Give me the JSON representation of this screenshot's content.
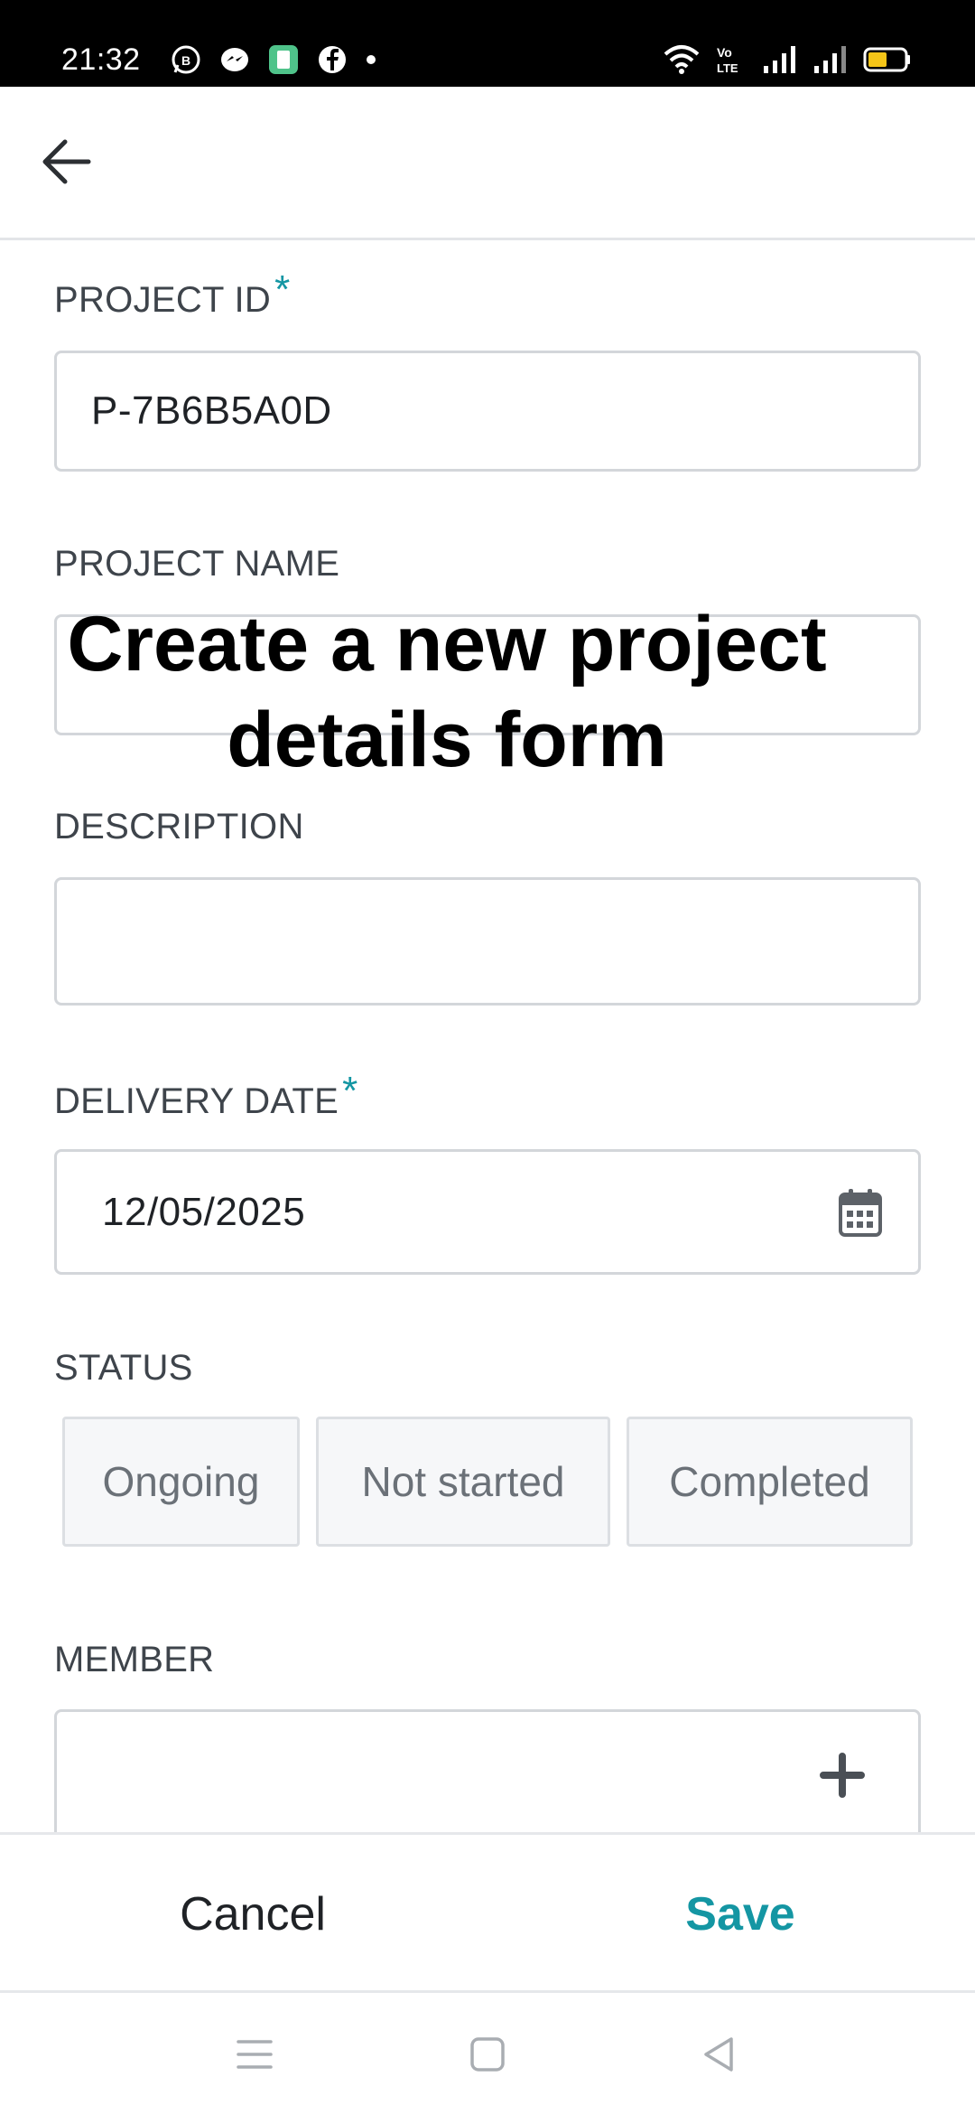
{
  "status_bar": {
    "time": "21:32",
    "left_icons": [
      "whatsapp-business-icon",
      "messenger-icon",
      "calculator-app-icon",
      "facebook-icon",
      "dot-icon"
    ],
    "right_icons": [
      "wifi-icon",
      "volte-icon",
      "signal-icon",
      "signal-icon",
      "battery-icon"
    ],
    "volte_label": "Vo LTE",
    "battery_level": 0.15
  },
  "header": {
    "back_icon": "arrow-left-icon"
  },
  "form": {
    "project_id": {
      "label": "PROJECT ID",
      "required_mark": "*",
      "value": "P-7B6B5A0D"
    },
    "project_name": {
      "label": "PROJECT NAME",
      "value": ""
    },
    "description": {
      "label": "DESCRIPTION",
      "value": ""
    },
    "delivery_date": {
      "label": "DELIVERY DATE",
      "required_mark": "*",
      "value": "12/05/2025",
      "icon": "calendar-icon"
    },
    "status": {
      "label": "STATUS",
      "options": [
        "Ongoing",
        "Not started",
        "Completed"
      ]
    },
    "member": {
      "label": "MEMBER",
      "value": "",
      "icon": "plus-icon"
    }
  },
  "overlay": {
    "line1": "Create a new project",
    "line2": "details form"
  },
  "actions": {
    "cancel_label": "Cancel",
    "save_label": "Save"
  },
  "system_nav": [
    "menu-icon",
    "home-icon",
    "back-triangle-icon"
  ],
  "colors": {
    "accent": "#1496a3",
    "label": "#3e444b",
    "border": "#d3d6da"
  }
}
